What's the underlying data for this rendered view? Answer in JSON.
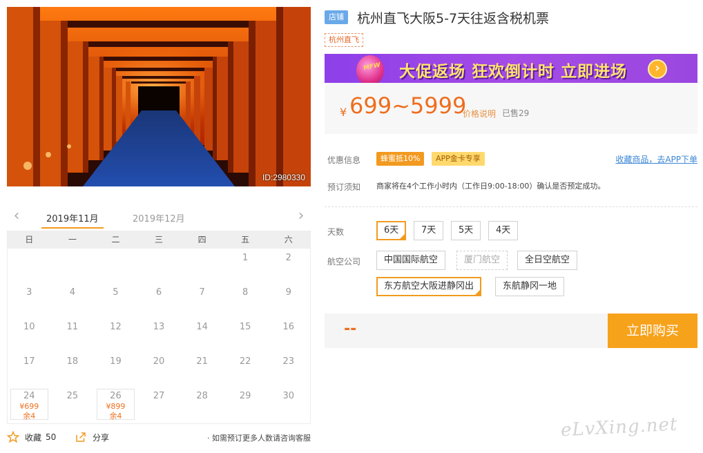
{
  "photo": {
    "id_label": "ID:2980330"
  },
  "calendar": {
    "months": [
      "2019年11月",
      "2019年12月"
    ],
    "weekdays": [
      "日",
      "一",
      "二",
      "三",
      "四",
      "五",
      "六"
    ],
    "rows": [
      [
        {
          "d": ""
        },
        {
          "d": ""
        },
        {
          "d": ""
        },
        {
          "d": ""
        },
        {
          "d": ""
        },
        {
          "d": "1"
        },
        {
          "d": "2"
        }
      ],
      [
        {
          "d": "3"
        },
        {
          "d": "4"
        },
        {
          "d": "5"
        },
        {
          "d": "6"
        },
        {
          "d": "7"
        },
        {
          "d": "8"
        },
        {
          "d": "9"
        }
      ],
      [
        {
          "d": "10"
        },
        {
          "d": "11"
        },
        {
          "d": "12"
        },
        {
          "d": "13"
        },
        {
          "d": "14"
        },
        {
          "d": "15"
        },
        {
          "d": "16"
        }
      ],
      [
        {
          "d": "17"
        },
        {
          "d": "18"
        },
        {
          "d": "19"
        },
        {
          "d": "20"
        },
        {
          "d": "21"
        },
        {
          "d": "22"
        },
        {
          "d": "23"
        }
      ],
      [
        {
          "d": "24",
          "price": "¥699",
          "left": "余4"
        },
        {
          "d": "25"
        },
        {
          "d": "26",
          "price": "¥899",
          "left": "余4"
        },
        {
          "d": "27"
        },
        {
          "d": "28"
        },
        {
          "d": "29"
        },
        {
          "d": "30"
        }
      ]
    ]
  },
  "footer": {
    "favorite_label": "收藏",
    "favorite_count": "50",
    "share_label": "分享",
    "consult_text": "· 如需预订更多人数请咨询客服"
  },
  "product": {
    "shop_badge": "店铺",
    "title": "杭州直飞大阪5-7天往返含税机票",
    "tag": "杭州直飞",
    "banner_text": "大促返场 狂欢倒计时 立即进场",
    "banner_logo": "MFW",
    "price_symbol": "¥",
    "price": "699~5999",
    "price_note": "价格说明",
    "sold": "已售29"
  },
  "info": {
    "discount_label": "优惠信息",
    "bee_pill": "蜂蜜抵10%",
    "app_pill": "APP金卡专享",
    "app_link": "收藏商品，去APP下单",
    "notice_label": "预订须知",
    "notice_text": "商家将在4个工作小时内（工作日9:00-18:00）确认是否预定成功。"
  },
  "options": {
    "days_label": "天数",
    "days": [
      "6天",
      "7天",
      "5天",
      "4天"
    ],
    "airline_label": "航空公司",
    "airlines": [
      "中国国际航空",
      "厦门航空",
      "全日空航空",
      "东方航空大阪进静冈出",
      "东航静冈一地"
    ]
  },
  "buy": {
    "placeholder": "--",
    "button": "立即购买"
  },
  "watermark": "eLvXing.net",
  "colors": {
    "accent": "#f29a1f",
    "price": "#ee6e1e",
    "link": "#3b86d6",
    "banner": "#9a47e0"
  }
}
